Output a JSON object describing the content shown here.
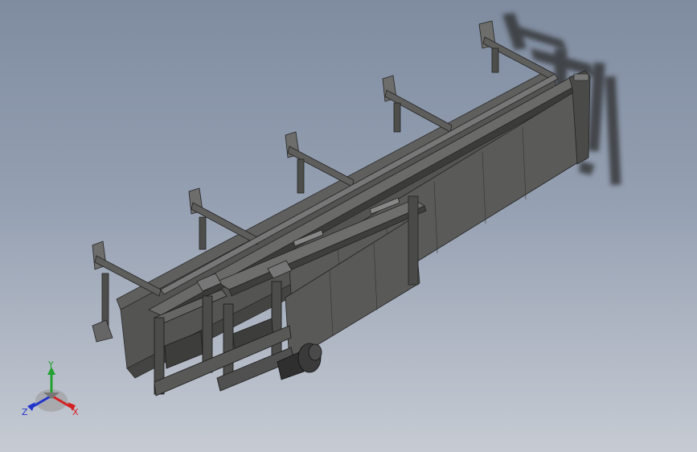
{
  "viewport": {
    "background_top": "#7f8ca0",
    "background_bottom": "#c6cbd3"
  },
  "model": {
    "frame_color": "#4a4a48",
    "panel_color": "#555553",
    "rail_color": "#3a3a38",
    "shadow_color": "#2e2e2e"
  },
  "triad": {
    "x_label": "X",
    "y_label": "Y",
    "z_label": "Z",
    "x_color": "#d42020",
    "y_color": "#22a030",
    "z_color": "#2233cc"
  }
}
